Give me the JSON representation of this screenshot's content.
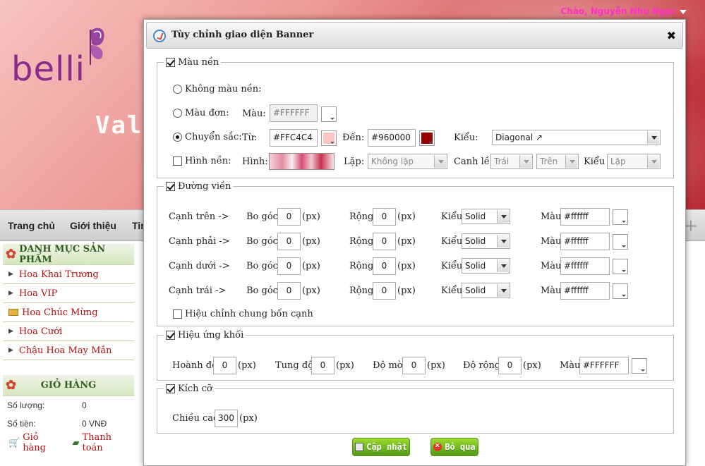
{
  "user": {
    "greeting": "Chào, Nguyễn Như Ngọc"
  },
  "banner": {
    "logo_text": "belli",
    "text": "Val"
  },
  "nav": {
    "items": [
      "Trang chủ",
      "Giới thiệu",
      "Tin"
    ]
  },
  "sidebar": {
    "category_title": "DANH MỤC SẢN PHẨM",
    "categories": [
      "Hoa Khai Trương",
      "Hoa VIP",
      "Hoa Chúc Mừng",
      "Hoa Cưới",
      "Chậu Hoa May Mắn"
    ],
    "cart_title": "GIỎ HÀNG",
    "cart_qty_label": "Số lượng:",
    "cart_qty_value": "0",
    "cart_total_label": "Số tiền:",
    "cart_total_value": "0 VNĐ",
    "cart_link": "Giỏ hàng",
    "checkout_link": "Thanh toán"
  },
  "modal": {
    "title": "Tùy chỉnh giao diện Banner",
    "background": {
      "legend": "Màu nền",
      "no_color_label": "Không màu nền:",
      "solid_label": "Màu đơn:",
      "color_label": "Màu:",
      "solid_value": "#FFFFFF",
      "gradient_label": "Chuyển sắc:",
      "from_label": "Từ:",
      "from_value": "#FFC4C4",
      "from_color": "#FFC4C4",
      "to_label": "Đến:",
      "to_value": "#960000",
      "to_color": "#960000",
      "style_label": "Kiểu:",
      "style_value": "Diagonal ↗",
      "image_label": "Hình nền:",
      "image_field_label": "Hình:",
      "repeat_label": "Lặp:",
      "repeat_value": "Không lặp",
      "align_label": "Canh lề:",
      "align_h_value": "Trái",
      "align_v_value": "Trên",
      "kind_label": "Kiểu",
      "kind_value": "Lặp"
    },
    "border": {
      "legend": "Đường viền",
      "radius_label": "Bo góc:",
      "width_label": "Rộng:",
      "unit": "(px)",
      "style_label": "Kiểu:",
      "color_label": "Màu:",
      "rows": [
        {
          "side": "Cạnh trên ->",
          "radius": "0",
          "width": "0",
          "style": "Solid",
          "color": "#ffffff"
        },
        {
          "side": "Cạnh phải ->",
          "radius": "0",
          "width": "0",
          "style": "Solid",
          "color": "#ffffff"
        },
        {
          "side": "Cạnh dưới ->",
          "radius": "0",
          "width": "0",
          "style": "Solid",
          "color": "#ffffff"
        },
        {
          "side": "Cạnh trái ->",
          "radius": "0",
          "width": "0",
          "style": "Solid",
          "color": "#ffffff"
        }
      ],
      "common_label": "Hiệu chỉnh chung bốn cạnh"
    },
    "shadow": {
      "legend": "Hiệu ứng khối",
      "x_label": "Hoành độ:",
      "x_value": "0",
      "y_label": "Tung độ:",
      "y_value": "0",
      "blur_label": "Độ mờ:",
      "blur_value": "0",
      "spread_label": "Độ rộng:",
      "spread_value": "0",
      "unit": "(px)",
      "color_label": "Màu:",
      "color_value": "#FFFFFF"
    },
    "size": {
      "legend": "Kích cỡ",
      "height_label": "Chiều cao:",
      "height_value": "300",
      "unit": "(px)"
    },
    "buttons": {
      "update": "Cập nhật",
      "cancel": "Bỏ qua"
    }
  }
}
